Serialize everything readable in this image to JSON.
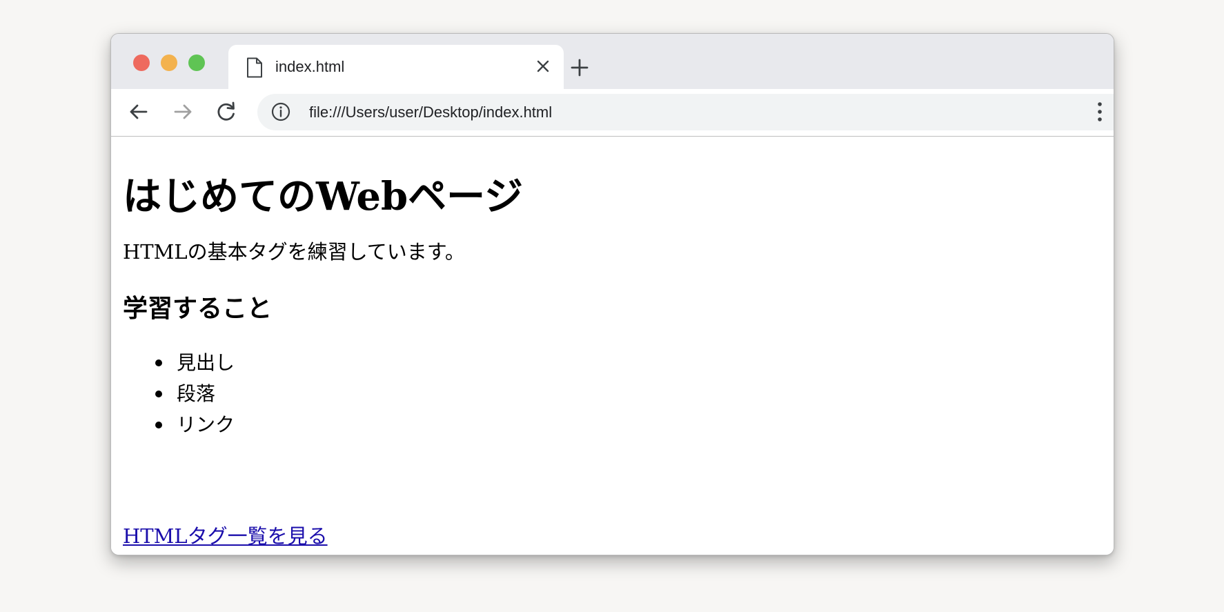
{
  "browser": {
    "tab": {
      "title": "index.html",
      "icon": "file-icon",
      "close_icon": "close-icon"
    },
    "new_tab_icon": "plus-icon",
    "nav": {
      "back_icon": "arrow-left-icon",
      "forward_icon": "arrow-right-icon",
      "reload_icon": "reload-icon",
      "menu_icon": "kebab-menu-icon"
    },
    "address_bar": {
      "info_icon": "info-icon",
      "url": "file:///Users/user/Desktop/index.html",
      "bookmark_icon": "star-icon"
    },
    "colors": {
      "close_light": "#ee6a5e",
      "minimize_light": "#f3b24e",
      "maximize_light": "#5fc454",
      "link": "#1a0dab"
    }
  },
  "page": {
    "heading": "はじめてのWebページ",
    "paragraph": "HTMLの基本タグを練習しています。",
    "subheading": "学習すること",
    "list_items": [
      "見出し",
      "段落",
      "リンク"
    ],
    "link_text": "HTMLタグ一覧を見る"
  }
}
